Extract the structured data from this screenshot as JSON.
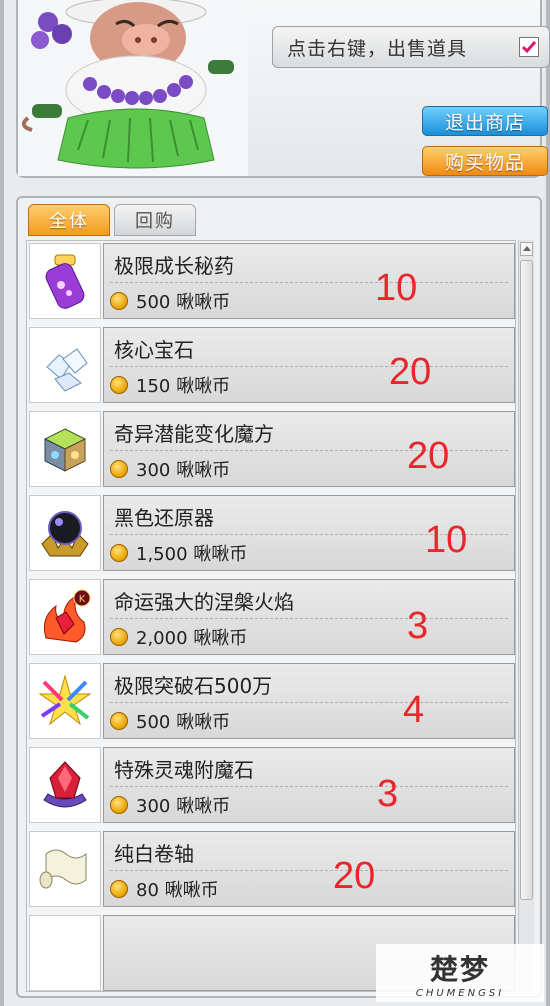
{
  "header": {
    "sell_toggle_label": "点击右键，出售道具",
    "sell_toggle_checked": true,
    "exit_button_label": "退出商店",
    "buy_button_label": "购买物品"
  },
  "tabs": [
    {
      "label": "全体",
      "active": true
    },
    {
      "label": "回购",
      "active": false
    }
  ],
  "items": [
    {
      "name": "极限成长秘药",
      "price": "500 啾啾币",
      "qty": "10",
      "icon": "purple-potion-vial-icon"
    },
    {
      "name": "核心宝石",
      "price": "150 啾啾币",
      "qty": "20",
      "icon": "white-crystal-cluster-icon"
    },
    {
      "name": "奇异潜能变化魔方",
      "price": "300 啾啾币",
      "qty": "20",
      "icon": "magic-cube-icon"
    },
    {
      "name": "黑色还原器",
      "price": "1,500 啾啾币",
      "qty": "10",
      "icon": "black-orb-restorer-icon"
    },
    {
      "name": "命运强大的涅槃火焰",
      "price": "2,000 啾啾币",
      "qty": "3",
      "icon": "nirvana-flame-crystal-icon"
    },
    {
      "name": "极限突破石500万",
      "price": "500 啾啾币",
      "qty": "4",
      "icon": "rainbow-star-burst-icon"
    },
    {
      "name": "特殊灵魂附魔石",
      "price": "300 啾啾币",
      "qty": "3",
      "icon": "red-soul-gem-icon"
    },
    {
      "name": "纯白卷轴",
      "price": "80 啾啾币",
      "qty": "20",
      "icon": "white-scroll-icon"
    }
  ],
  "watermark": {
    "main": "楚梦",
    "sub": "CHUMENGSI"
  },
  "colors": {
    "accent_orange": "#f29b1f",
    "accent_blue": "#1a8fd8",
    "qty_red": "#e8262b"
  }
}
